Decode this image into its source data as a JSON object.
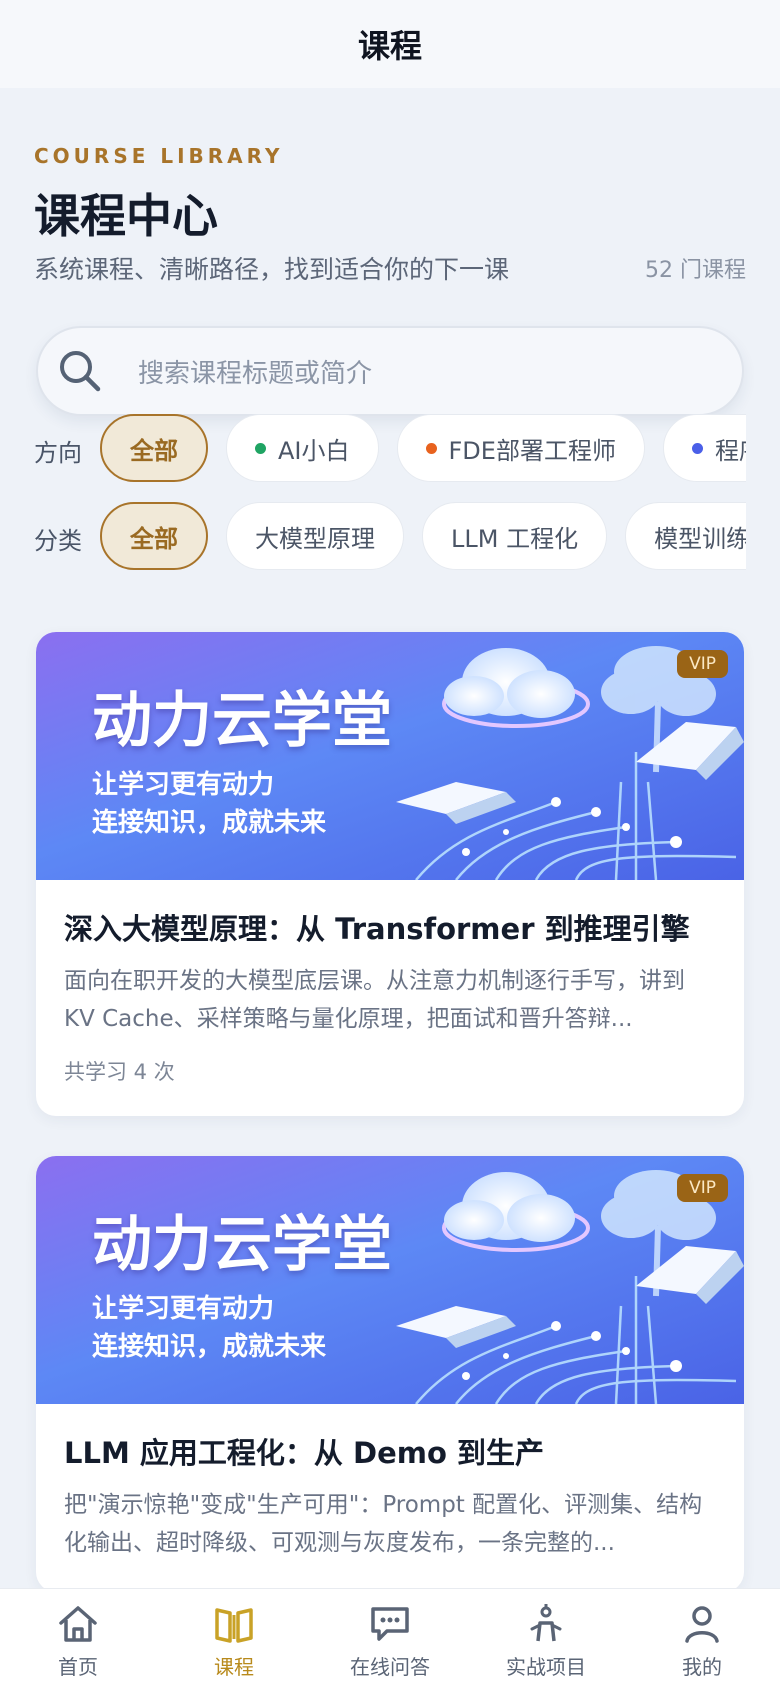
{
  "navbar": {
    "title": "课程"
  },
  "header": {
    "eyebrow": "COURSE LIBRARY",
    "title": "课程中心",
    "subtitle": "系统课程、清晰路径，找到适合你的下一课",
    "count": "52 门课程"
  },
  "search": {
    "placeholder": "搜索课程标题或简介"
  },
  "filters": {
    "direction": {
      "label": "方向",
      "chips": [
        {
          "label": "全部",
          "active": true
        },
        {
          "label": "AI小白",
          "dot": "#1fa463"
        },
        {
          "label": "FDE部署工程师",
          "dot": "#e8621e"
        },
        {
          "label": "程序员",
          "dot": "#4a5fe8"
        }
      ]
    },
    "category": {
      "label": "分类",
      "chips": [
        {
          "label": "全部",
          "active": true
        },
        {
          "label": "大模型原理"
        },
        {
          "label": "LLM 工程化"
        },
        {
          "label": "模型训练"
        }
      ]
    }
  },
  "courses": [
    {
      "brand": "动力云学堂",
      "slogan1": "让学习更有动力",
      "slogan2": "连接知识，成就未来",
      "badge": "VIP",
      "title": "深入大模型原理：从 Transformer 到推理引擎",
      "desc": "面向在职开发的大模型底层课。从注意力机制逐行手写，讲到 KV Cache、采样策略与量化原理，把面试和晋升答辩...",
      "meta": "共学习 4 次"
    },
    {
      "brand": "动力云学堂",
      "slogan1": "让学习更有动力",
      "slogan2": "连接知识，成就未来",
      "badge": "VIP",
      "title": "LLM 应用工程化：从 Demo 到生产",
      "desc": "把\"演示惊艳\"变成\"生产可用\"：Prompt 配置化、评测集、结构化输出、超时降级、可观测与灰度发布，一条完整的...",
      "meta": ""
    }
  ],
  "tabbar": [
    {
      "label": "首页",
      "icon": "home-icon"
    },
    {
      "label": "课程",
      "icon": "book-icon",
      "active": true
    },
    {
      "label": "在线问答",
      "icon": "chat-icon"
    },
    {
      "label": "实战项目",
      "icon": "project-icon"
    },
    {
      "label": "我的",
      "icon": "user-icon"
    }
  ],
  "colors": {
    "accent": "#a8742a",
    "active_tab": "#b88a1c",
    "background": "#eef2f8"
  }
}
